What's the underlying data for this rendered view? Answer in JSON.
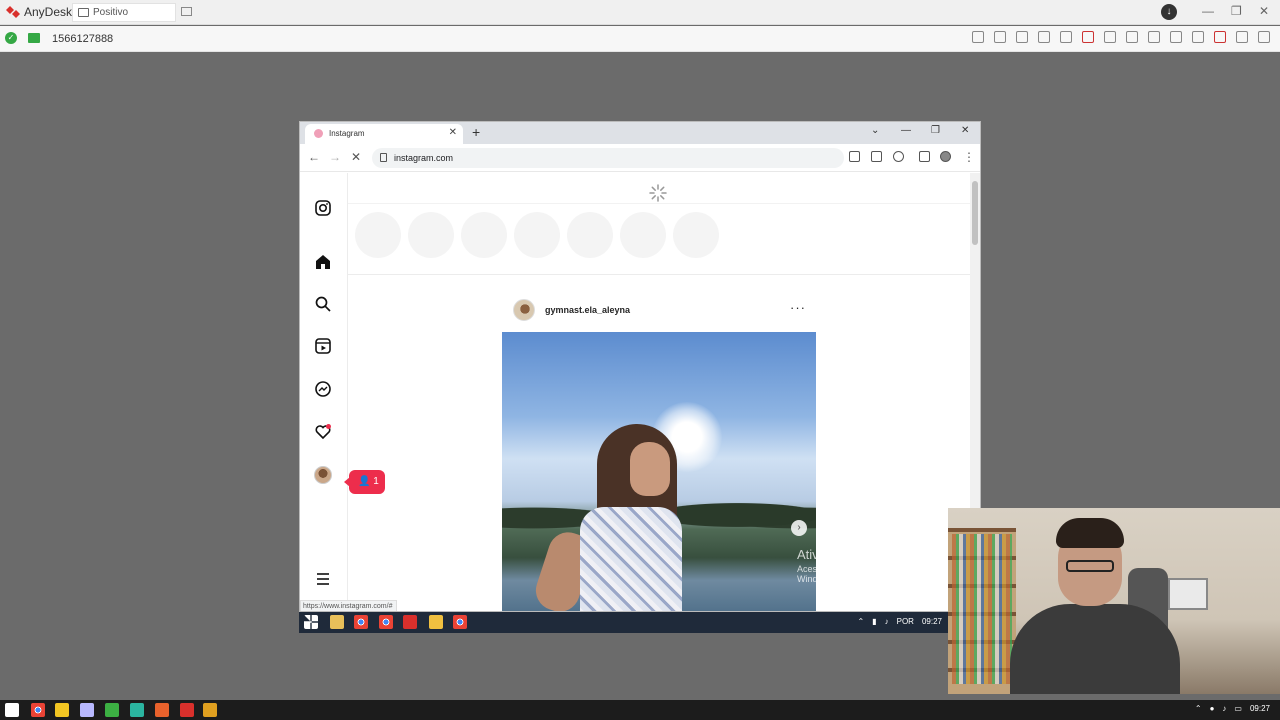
{
  "anydesk": {
    "app_name": "AnyDesk",
    "tab_label": "Positivo",
    "session_id": "1566127888",
    "minimize": "—",
    "restore": "❐",
    "close": "✕",
    "download_glyph": "↓"
  },
  "browser": {
    "tab_title": "Instagram",
    "tab_close": "✕",
    "new_tab": "+",
    "chevron": "⌄",
    "minimize": "—",
    "restore": "❐",
    "close": "✕",
    "back": "←",
    "forward": "→",
    "stop": "✕",
    "url": "instagram.com",
    "menu": "⋮"
  },
  "instagram": {
    "post_username": "gymnast.ela_aleyna",
    "post_more": "···",
    "next_glyph": "›",
    "notification_count": "1",
    "status_url": "https://www.instagram.com/#",
    "sidebar": [
      "instagram-logo",
      "home",
      "search",
      "reels",
      "messenger",
      "notifications",
      "profile",
      "more"
    ]
  },
  "watermark": {
    "title": "Ativar o Windows",
    "subtitle": "Acesse Configurações para ativar o Windows."
  },
  "remote_taskbar": {
    "language": "POR",
    "time": "09:27"
  },
  "local_taskbar": {
    "time": "09:27"
  },
  "colors": {
    "notification": "#ed2d4c",
    "anydesk_red": "#d9302c",
    "ok_green": "#35a845"
  }
}
